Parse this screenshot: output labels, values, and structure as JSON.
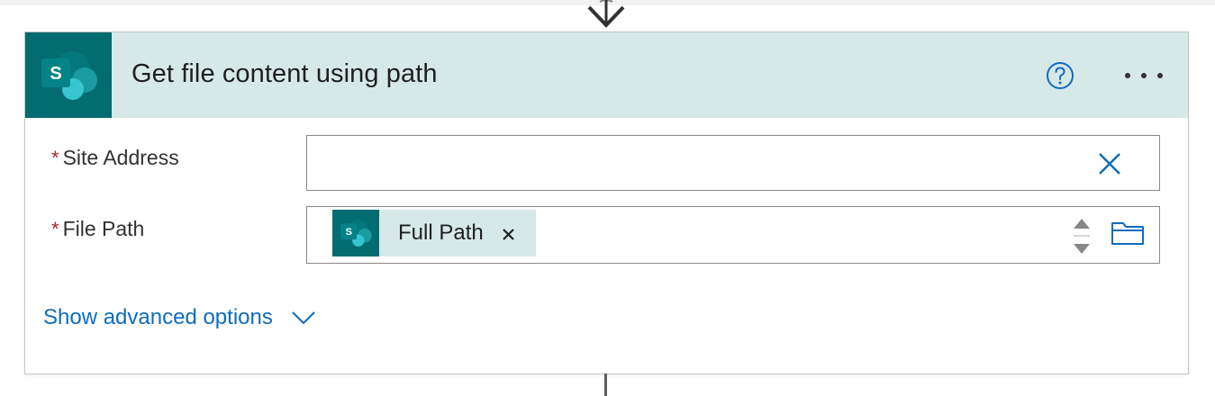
{
  "action_card": {
    "title": "Get file content using path",
    "connector_icon": "sharepoint-icon",
    "header_icons": [
      "help-circle-icon",
      "more-horizontal-icon"
    ],
    "fields": [
      {
        "label": "Site Address",
        "required_mark": "*",
        "value": "",
        "action_icon": "clear-x-icon"
      },
      {
        "label": "File Path",
        "required_mark": "*",
        "token": {
          "label": "Full Path",
          "icon": "sharepoint-icon",
          "remove_icon": "close-icon"
        },
        "action_icons": [
          "spinner-up-down-icon",
          "folder-icon"
        ]
      }
    ],
    "advanced_options": {
      "label": "Show advanced options",
      "icon": "chevron-down-icon"
    }
  },
  "colors": {
    "header_bg": "#d7e8e9",
    "sharepoint_teal": "#036c70",
    "link_blue": "#0f6cbd",
    "required_red": "#a4262c"
  }
}
